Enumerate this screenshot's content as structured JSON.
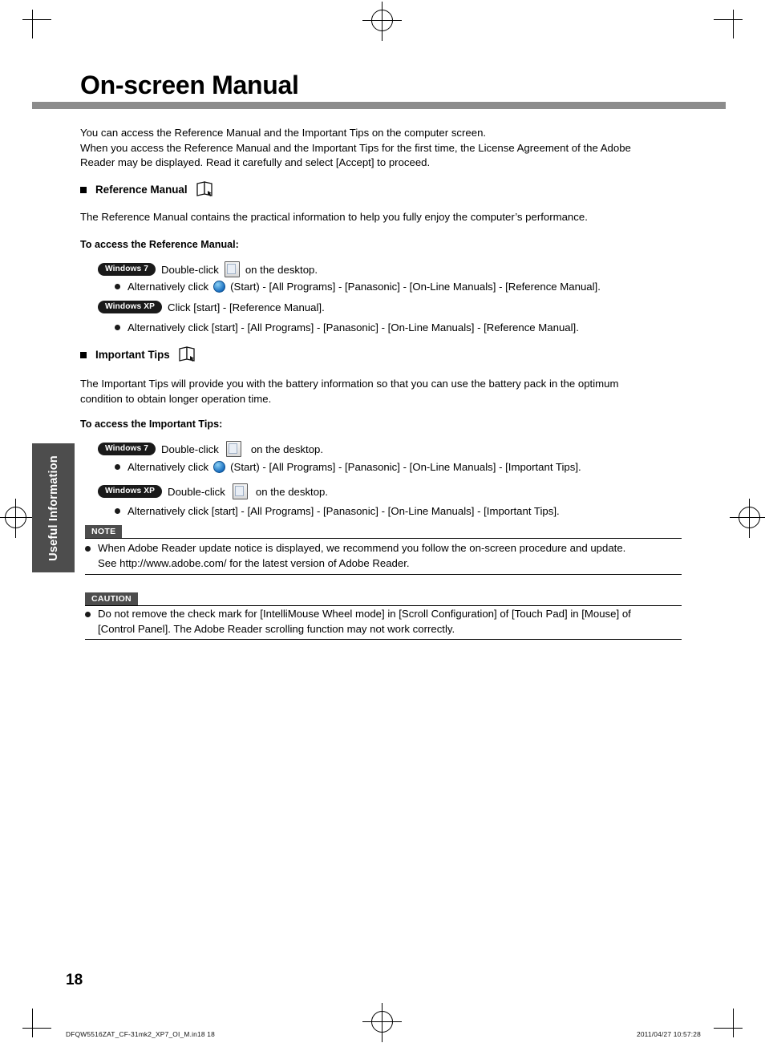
{
  "page": {
    "title": "On-screen Manual",
    "side_tab": "Useful Information",
    "number": "18"
  },
  "intro": {
    "line1": "You can access the Reference Manual and the Important Tips on the computer screen.",
    "line2": "When you access the Reference Manual and the Important Tips for the first time, the License Agreement of the Adobe",
    "line3": "Reader may be displayed. Read it carefully and select [Accept] to proceed."
  },
  "reference": {
    "heading": "Reference Manual",
    "description": "The Reference Manual contains the practical information to help you fully enjoy the computer’s performance.",
    "access_heading": "To access the Reference Manual:",
    "win7_badge": "Windows 7",
    "win7_step": "Double-click",
    "win7_step_tail": "on the desktop.",
    "win7_alt_pre": "Alternatively click",
    "win7_alt_post": "(Start) - [All Programs] - [Panasonic] - [On-Line Manuals] - [Reference Manual].",
    "winxp_badge": "Windows XP",
    "winxp_step": "Click [start] - [Reference Manual].",
    "winxp_alt": "Alternatively click [start] - [All Programs] - [Panasonic] - [On-Line Manuals] - [Reference Manual]."
  },
  "tips": {
    "heading": "Important Tips",
    "description_l1": "The Important Tips will provide you with the battery information so that you can use the battery pack in the optimum",
    "description_l2": "condition to obtain longer operation time.",
    "access_heading": "To access the Important Tips:",
    "win7_badge": "Windows 7",
    "win7_step": "Double-click",
    "win7_step_tail": "on the desktop.",
    "win7_alt_pre": "Alternatively click",
    "win7_alt_post": "(Start) - [All Programs] - [Panasonic] - [On-Line Manuals] - [Important Tips].",
    "winxp_badge": "Windows XP",
    "winxp_step": "Double-click",
    "winxp_step_tail": "on the desktop.",
    "winxp_alt": "Alternatively click [start] - [All Programs] - [Panasonic] - [On-Line Manuals] - [Important Tips]."
  },
  "note": {
    "tag": "NOTE",
    "line1": "When Adobe Reader update notice is displayed, we recommend you follow the on-screen procedure and update.",
    "line2": "See http://www.adobe.com/ for the latest version of Adobe Reader."
  },
  "caution": {
    "tag": "CAUTION",
    "line1": "Do not remove the check mark for [IntelliMouse Wheel mode] in [Scroll Configuration] of [Touch Pad] in [Mouse] of",
    "line2": "[Control Panel]. The Adobe Reader scrolling function may not work correctly."
  },
  "footer": {
    "left": "DFQW5516ZAT_CF-31mk2_XP7_OI_M.in18    18",
    "right": "2011/04/27   10:57:28"
  }
}
